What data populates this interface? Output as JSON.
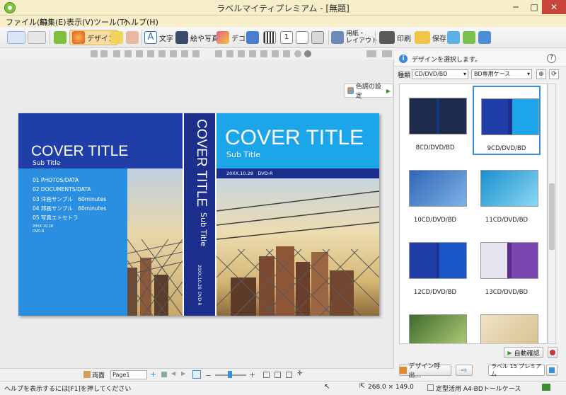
{
  "window": {
    "title": "ラベルマイティプレミアム - [無題]"
  },
  "menu": [
    "ファイル(F)",
    "編集(E)",
    "表示(V)",
    "ツール(T)",
    "ヘルプ(H)"
  ],
  "toolbar": {
    "design": "デザイン",
    "text": "文字",
    "picture": "絵や写真",
    "deco": "デコ",
    "paper": "用紙・\nレイアウト",
    "print": "印刷",
    "save": "保存"
  },
  "canvas": {
    "color_settings": "色調の設定",
    "back": {
      "title": "COVER TITLE",
      "subtitle": "Sub Title",
      "tracks": [
        "01 PHOTOS/DATA",
        "02 DOCUMENTS/DATA",
        "03 洋画サンプル　60minutes",
        "04 邦画サンプル　60minutes",
        "05 写真エトセトラ"
      ],
      "date": "20XX.10.28",
      "media": "DVD-R"
    },
    "spine": {
      "title": "COVER TITLE",
      "subtitle": "Sub Title",
      "date": "20XX.10.28",
      "media": "DVD-R"
    },
    "front": {
      "title": "COVER TITLE",
      "subtitle": "Sub Title",
      "date_media": "20XX.10.28　DVD-R"
    }
  },
  "bottom": {
    "both_sides": "両面",
    "page": "Page1"
  },
  "panel": {
    "hint": "デザインを選択します。",
    "filter_label": "種類",
    "filter_value": "CD/DVD/BD",
    "case_value": "BD専用ケース",
    "thumbs": [
      "8CD/DVD/BD",
      "9CD/DVD/BD",
      "10CD/DVD/BD",
      "11CD/DVD/BD",
      "12CD/DVD/BD",
      "13CD/DVD/BD"
    ],
    "auto_check": "自動確認",
    "design_call": "デザイン呼出...",
    "label_name": "ラベル 15 プレミアム"
  },
  "status": {
    "help": "ヘルプを表示するには[F1]を押してください",
    "size": "268.0 × 149.0",
    "paper": "定型活用 A4-BDトールケース"
  }
}
